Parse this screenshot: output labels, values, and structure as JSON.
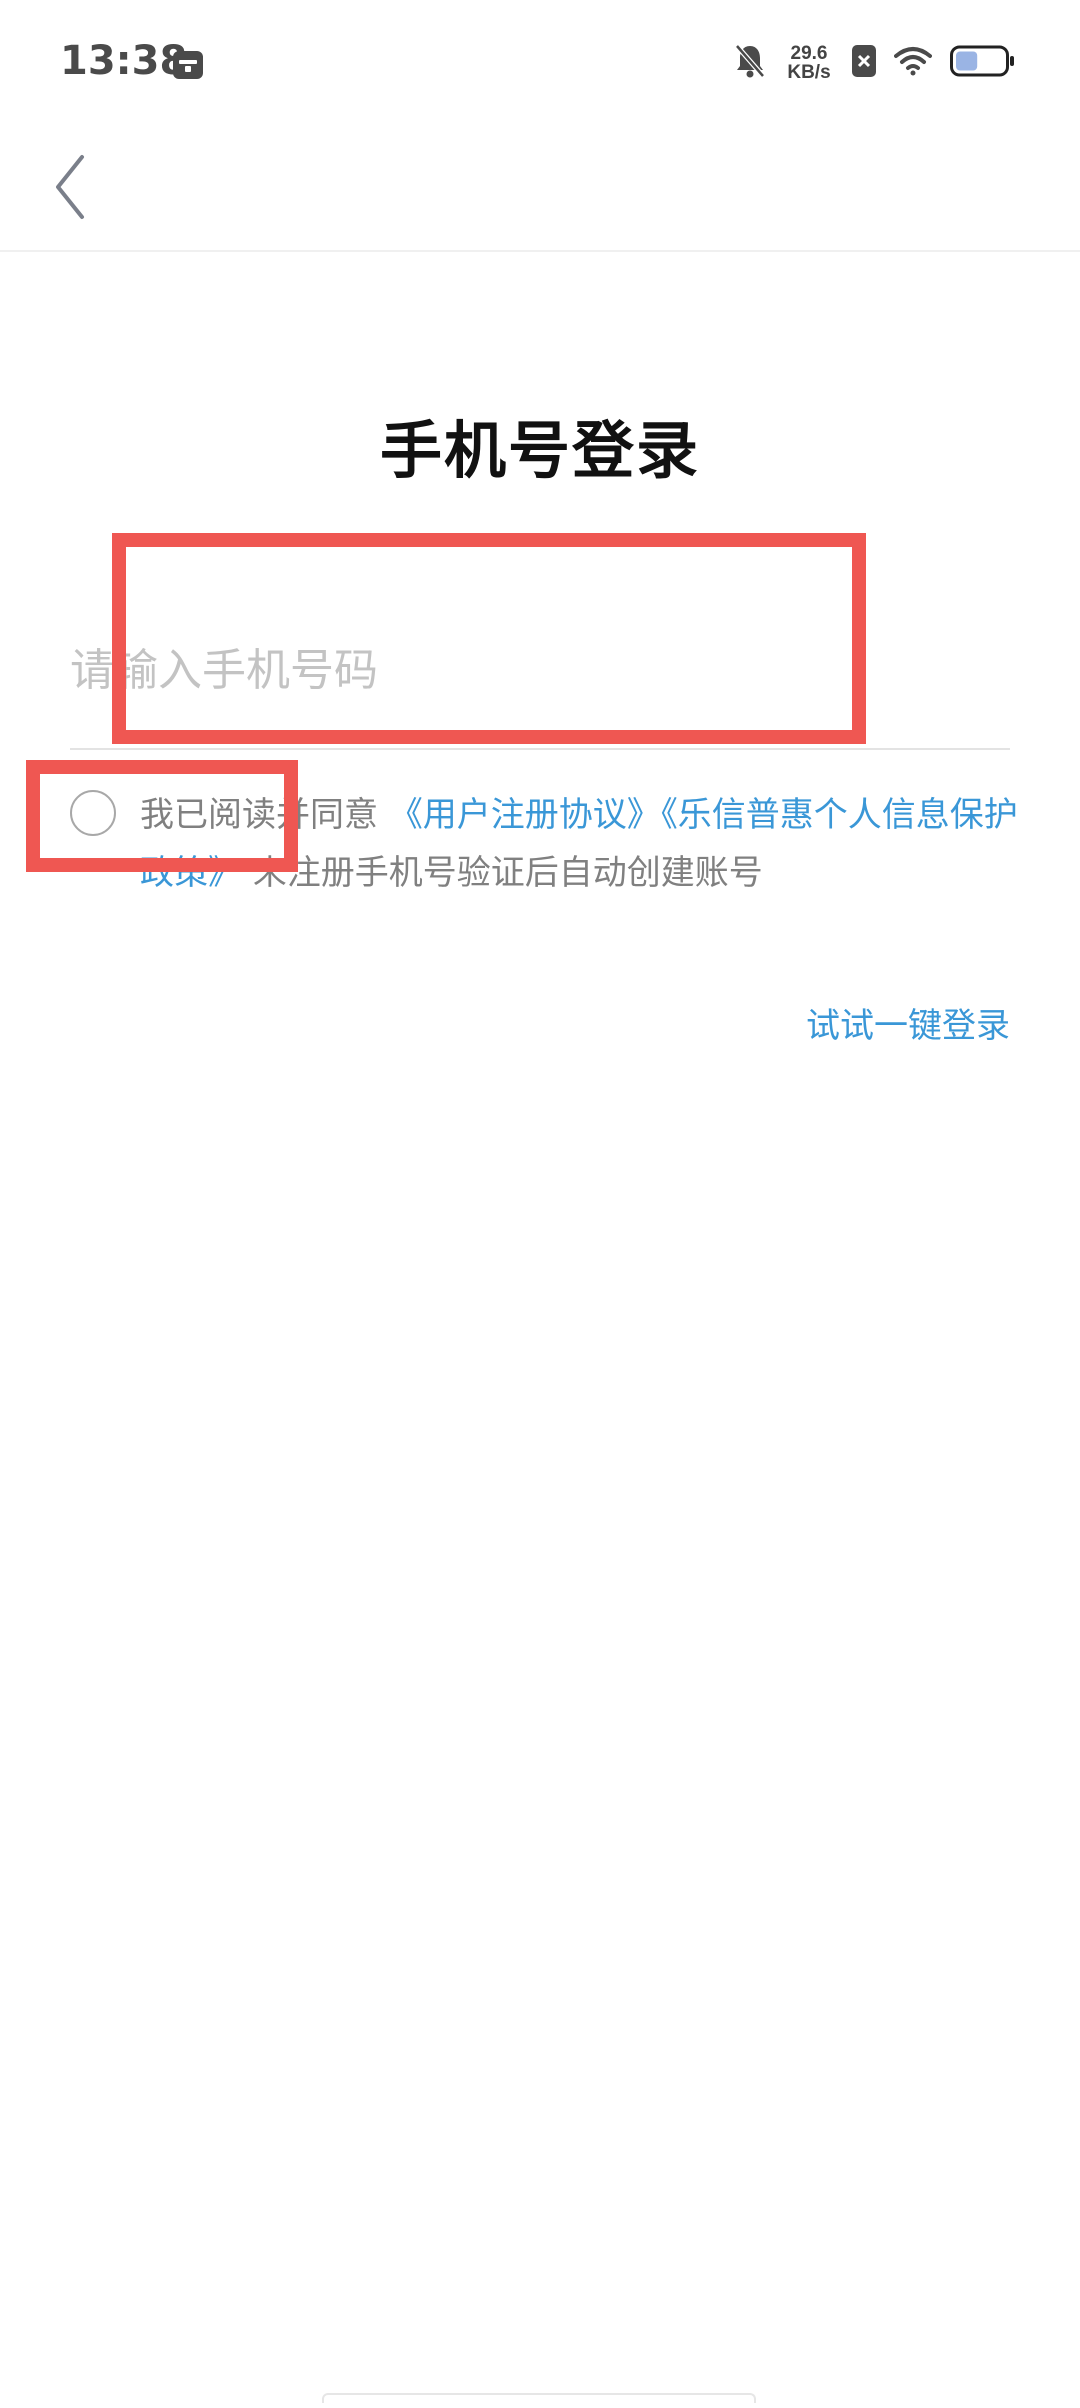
{
  "status_bar": {
    "time": "13:38",
    "net_speed_value": "29.6",
    "net_speed_unit": "KB/s",
    "battery_level": 0.45,
    "icons": [
      "calendar-icon",
      "bell-off-icon",
      "sim-off-icon",
      "wifi-icon",
      "battery-icon"
    ]
  },
  "header": {
    "back_icon": "chevron-left-icon"
  },
  "title": "手机号登录",
  "phone_input": {
    "placeholder": "请输入手机号码",
    "value": ""
  },
  "agreement": {
    "checked": false,
    "prefix": "我已阅读并同意",
    "link_user_agreement": "《用户注册协议》",
    "link_privacy_policy": "《乐信普惠个人信息保护政策》",
    "suffix": "未注册手机号验证后自动创建账号"
  },
  "one_tap_login": "试试一键登录",
  "colors": {
    "link": "#3a97d7",
    "placeholder": "#c3c3c3",
    "annotation": "#ef5752",
    "text_muted": "#808080"
  }
}
